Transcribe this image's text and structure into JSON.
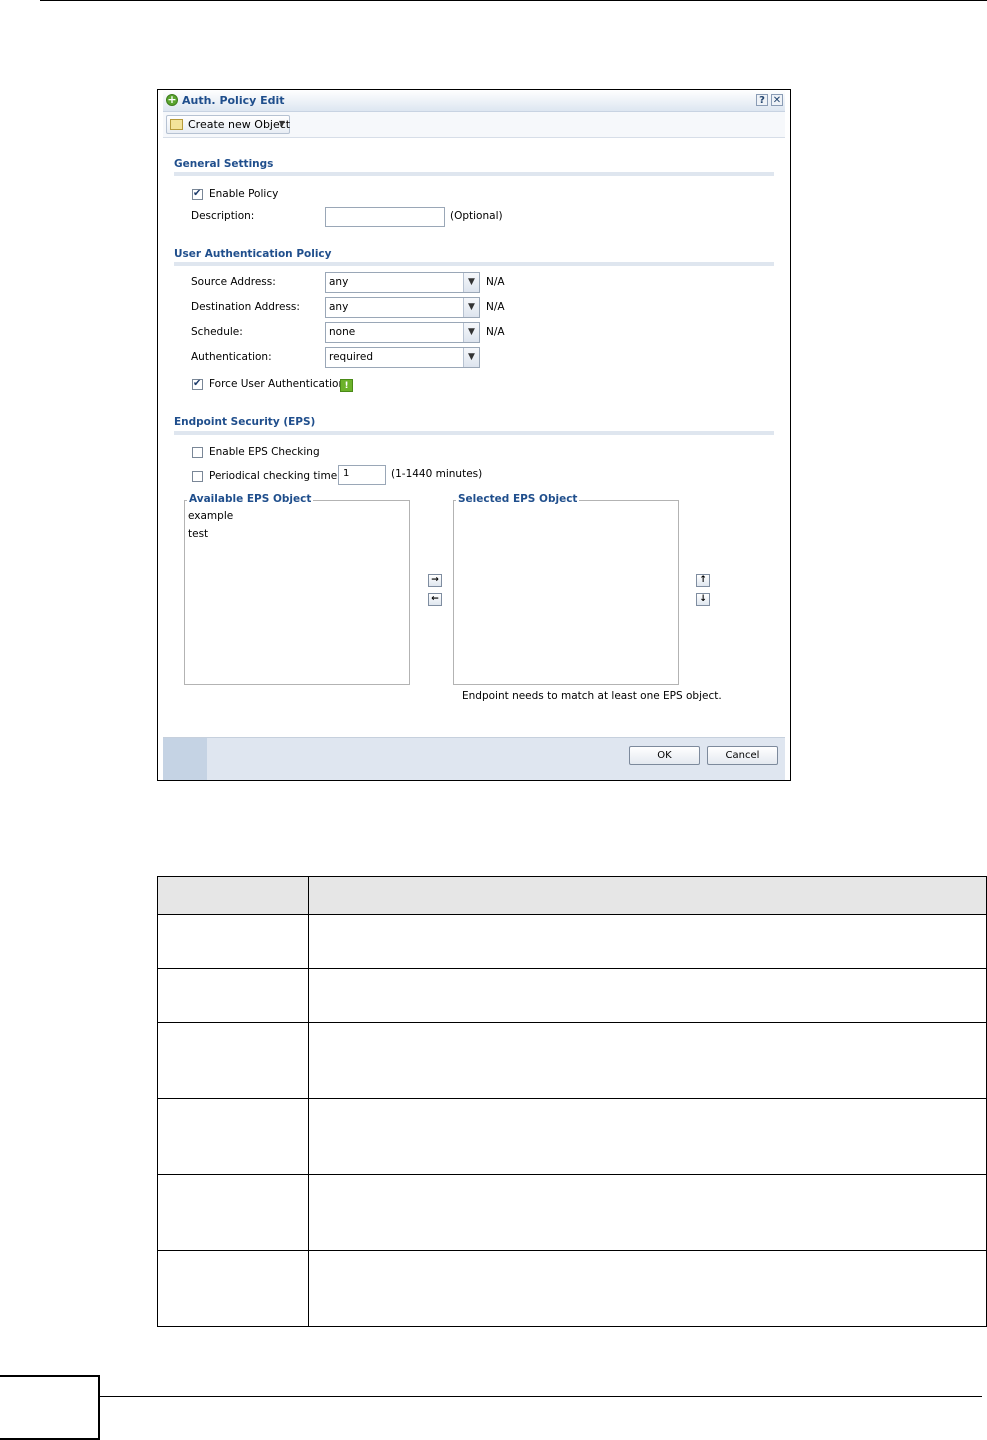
{
  "dialog": {
    "title": "Auth. Policy Edit",
    "help_symbol": "?",
    "close_symbol": "✕",
    "toolbar": {
      "create_label": "Create new Object"
    },
    "general": {
      "heading": "General Settings",
      "enable_policy_label": "Enable Policy",
      "enable_policy_checked": true,
      "description_label": "Description:",
      "description_value": "",
      "optional_label": "(Optional)"
    },
    "user_auth": {
      "heading": "User Authentication Policy",
      "rows": [
        {
          "label": "Source Address:",
          "value": "any",
          "note": "N/A"
        },
        {
          "label": "Destination Address:",
          "value": "any",
          "note": "N/A"
        },
        {
          "label": "Schedule:",
          "value": "none",
          "note": "N/A"
        },
        {
          "label": "Authentication:",
          "value": "required",
          "note": ""
        }
      ],
      "force_label": "Force User Authentication",
      "force_checked": true,
      "warn_symbol": "!"
    },
    "eps": {
      "heading": "Endpoint Security (EPS)",
      "enable_label": "Enable EPS Checking",
      "enable_checked": false,
      "periodic_label": "Periodical checking time",
      "periodic_checked": false,
      "periodic_value": "1",
      "periodic_range": "(1-1440 minutes)",
      "available_legend": "Available EPS Object",
      "available_items": [
        "example",
        "test"
      ],
      "selected_legend": "Selected EPS Object",
      "selected_items": [],
      "note": "Endpoint needs to match at least one EPS object."
    },
    "footer": {
      "ok_label": "OK",
      "cancel_label": "Cancel"
    }
  },
  "colors": {
    "accent": "#1f4e8c",
    "footer_bg": "#dfe6f0"
  },
  "icons": {
    "title": "add-circle-icon",
    "toolbar": "new-object-icon",
    "warning": "warning-icon"
  }
}
